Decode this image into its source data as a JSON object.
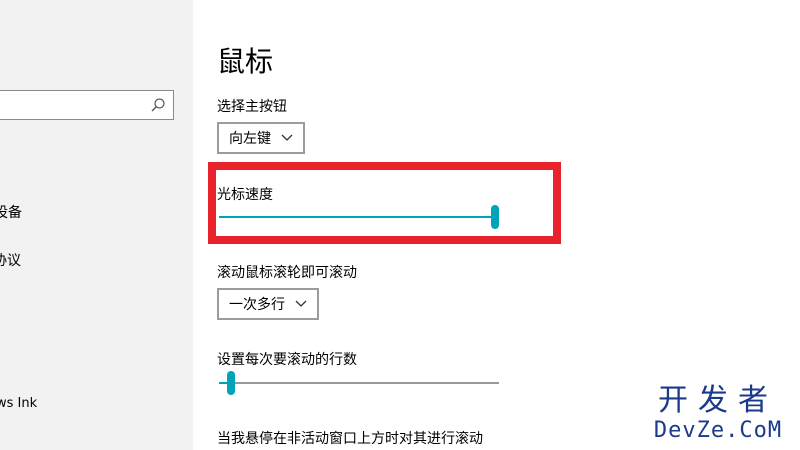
{
  "sidebar": {
    "search_placeholder": "",
    "items": [
      {
        "label": "设备"
      },
      {
        "label": "协议"
      },
      {
        "label": "ws Ink"
      }
    ]
  },
  "main": {
    "title": "鼠标",
    "primary_button": {
      "label": "选择主按钮",
      "value": "向左键"
    },
    "cursor_speed": {
      "label": "光标速度",
      "level_percent": 100
    },
    "scroll": {
      "label": "滚动鼠标滚轮即可滚动",
      "value": "一次多行"
    },
    "lines_per_scroll": {
      "label": "设置每次要滚动的行数",
      "level_percent": 3
    },
    "inactive_scroll": {
      "label": "当我悬停在非活动窗口上方时对其进行滚动"
    }
  },
  "watermark": {
    "line1": "开发者",
    "line2": "DevZe.CoM"
  },
  "colors": {
    "accent": "#00a3b8",
    "highlight": "#e8232c",
    "sidebar_bg": "#f2f2f2",
    "watermark": "#1a3a8a"
  }
}
